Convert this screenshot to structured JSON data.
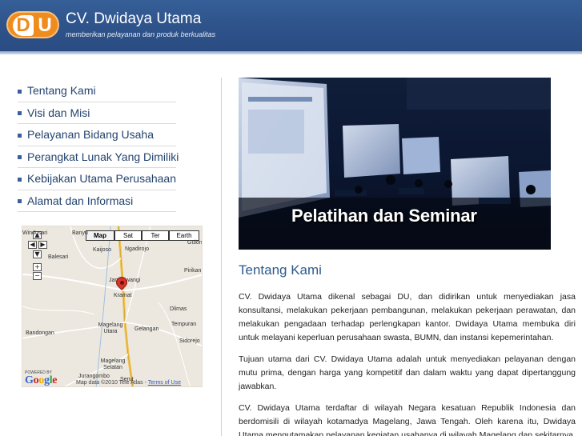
{
  "header": {
    "logo_left": "D",
    "logo_right": "U",
    "title": "CV. Dwidaya Utama",
    "tagline": "memberikan pelayanan dan produk berkualitas"
  },
  "nav": {
    "items": [
      {
        "label": "Tentang Kami"
      },
      {
        "label": "Visi dan Misi"
      },
      {
        "label": "Pelayanan Bidang Usaha"
      },
      {
        "label": "Perangkat Lunak Yang Dimiliki"
      },
      {
        "label": "Kebijakan Utama Perusahaan"
      },
      {
        "label": "Alamat dan Informasi"
      }
    ]
  },
  "map": {
    "types": [
      "Map",
      "Sat",
      "Ter",
      "Earth"
    ],
    "selected_type": "Map",
    "zoom_in": "+",
    "zoom_out": "−",
    "places": [
      "Windusari",
      "Banyu",
      "Kaijoso",
      "Ngadirojo",
      "Balesari",
      "Gulon",
      "Pirikan",
      "Jambewangi",
      "Kramat",
      "Dlimas",
      "Magelang Utara",
      "Tempuran",
      "Bandongan",
      "Sidorejo",
      "Magelang Selatan",
      "Gelangan",
      "Jurangombo",
      "Serut"
    ],
    "powered_by": "POWERED BY",
    "google": "Google",
    "attribution": "Map data ©2010 Tele Atlas - ",
    "terms": "Terms of Use",
    "colors": {
      "road": "#f2c24d",
      "pin": "#d8342b"
    }
  },
  "banner": {
    "caption": "Pelatihan dan Seminar"
  },
  "content": {
    "heading": "Tentang Kami",
    "paragraphs": [
      "CV. Dwidaya Utama dikenal sebagai DU, dan didirikan untuk menyediakan jasa konsultansi, melakukan pekerjaan pembangunan, melakukan pekerjaan perawatan, dan melakukan pengadaan terhadap perlengkapan kantor. Dwidaya Utama membuka diri untuk melayani keperluan perusahaan swasta, BUMN, dan instansi kepemerintahan.",
      "Tujuan utama dari CV. Dwidaya Utama adalah untuk menyediakan pelayanan dengan mutu prima, dengan harga yang kompetitif dan dalam waktu yang dapat dipertanggung jawabkan.",
      "CV. Dwidaya Utama terdaftar di wilayah Negara kesatuan Republik Indonesia dan berdomisili di wilayah kotamadya Magelang, Jawa Tengah. Oleh karena itu, Dwidaya Utama mengutamakan pelayanan kegiatan usahanya di wilayah Magelang dan sekitarnya."
    ]
  },
  "colors": {
    "header": "#2d5189",
    "nav_text": "#24446e",
    "heading": "#2e5a8c",
    "logo": "#f08c1e"
  }
}
